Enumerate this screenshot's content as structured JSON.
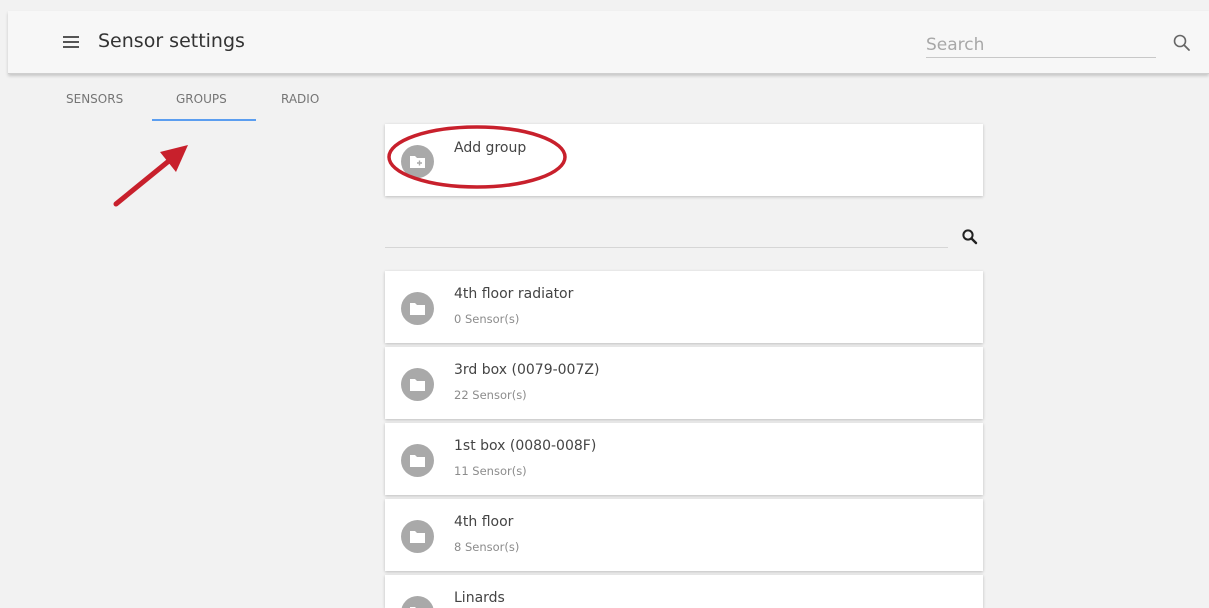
{
  "header": {
    "title": "Sensor settings",
    "search_placeholder": "Search"
  },
  "tabs": [
    {
      "label": "SENSORS"
    },
    {
      "label": "GROUPS",
      "active": true
    },
    {
      "label": "RADIO"
    }
  ],
  "add_group": {
    "label": "Add group"
  },
  "groups": [
    {
      "name": "4th floor radiator",
      "count": "0 Sensor(s)"
    },
    {
      "name": "3rd box (0079-007Z)",
      "count": "22 Sensor(s)"
    },
    {
      "name": "1st box (0080-008F)",
      "count": "11 Sensor(s)"
    },
    {
      "name": "4th floor",
      "count": "8 Sensor(s)"
    },
    {
      "name": "Linards",
      "count": ""
    }
  ],
  "colors": {
    "accent": "#5b9ef0",
    "annotation": "#c8202c",
    "avatar": "#a9a9a9"
  }
}
